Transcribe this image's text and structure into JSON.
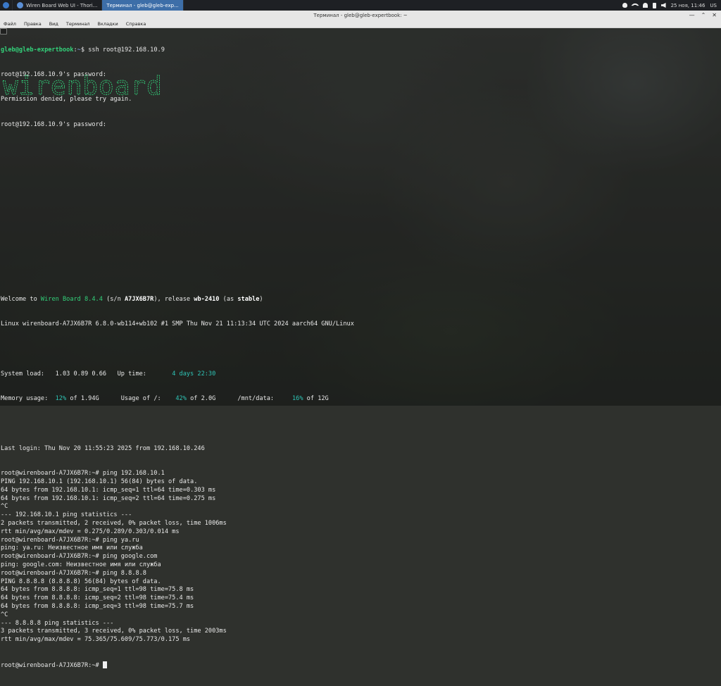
{
  "panel": {
    "tasks": [
      {
        "label": "Wiren Board Web UI - Thori...",
        "active": false
      },
      {
        "label": "Терминал - gleb@gleb-exp...",
        "active": true
      }
    ],
    "datetime": "25 ноя, 11:46",
    "keyboard_layout": "US"
  },
  "window": {
    "title": "Терминал - gleb@gleb-expertbook: ~",
    "menu": [
      "Файл",
      "Правка",
      "Вид",
      "Терминал",
      "Вкладки",
      "Справка"
    ]
  },
  "terminal": {
    "local_prompt_user": "gleb@gleb-expertbook",
    "local_prompt_path": "~",
    "local_cmd": "ssh root@192.168.10.9",
    "pw1": "root@192.168.10.9's password:",
    "denied": "Permission denied, please try again.",
    "pw2": "root@192.168.10.9's password:",
    "logo_text": "wirenboard",
    "welcome": {
      "prefix": "Welcome to ",
      "product": "Wiren Board 8.4.4",
      "sn_prefix": " (s/n ",
      "sn": "A7JX6B7R",
      "sn_suffix": "), release ",
      "release": "wb-2410",
      "as_prefix": " (as ",
      "as": "stable",
      "as_suffix": ")"
    },
    "uname": "Linux wirenboard-A7JX6B7R 6.8.0-wb114+wb102 #1 SMP Thu Nov 21 11:13:34 UTC 2024 aarch64 GNU/Linux",
    "sysload_label": "System load:   ",
    "sysload": "1.03 0.89 0.66",
    "uptime_label": "   Up time:       ",
    "uptime": "4 days 22:30",
    "mem_label": "Memory usage:  ",
    "mem_pct": "12%",
    "mem_of": " of 1.94G",
    "root_label": "      Usage of /:    ",
    "root_pct": "42%",
    "root_of": " of 2.0G",
    "data_label": "      /mnt/data:     ",
    "data_pct": "16%",
    "data_of": " of 12G",
    "last_login": "Last login: Thu Nov 20 11:55:23 2025 from 192.168.10.246",
    "remote_prompt": "root@wirenboard-A7JX6B7R:~#",
    "output": [
      {
        "prompt": true,
        "text": " ping 192.168.10.1"
      },
      {
        "prompt": false,
        "text": "PING 192.168.10.1 (192.168.10.1) 56(84) bytes of data."
      },
      {
        "prompt": false,
        "text": "64 bytes from 192.168.10.1: icmp_seq=1 ttl=64 time=0.303 ms"
      },
      {
        "prompt": false,
        "text": "64 bytes from 192.168.10.1: icmp_seq=2 ttl=64 time=0.275 ms"
      },
      {
        "prompt": false,
        "text": "^C"
      },
      {
        "prompt": false,
        "text": "--- 192.168.10.1 ping statistics ---"
      },
      {
        "prompt": false,
        "text": "2 packets transmitted, 2 received, 0% packet loss, time 1006ms"
      },
      {
        "prompt": false,
        "text": "rtt min/avg/max/mdev = 0.275/0.289/0.303/0.014 ms"
      },
      {
        "prompt": true,
        "text": " ping ya.ru"
      },
      {
        "prompt": false,
        "text": "ping: ya.ru: Неизвестное имя или служба"
      },
      {
        "prompt": true,
        "text": " ping google.com"
      },
      {
        "prompt": false,
        "text": "ping: google.com: Неизвестное имя или служба"
      },
      {
        "prompt": true,
        "text": " ping 8.8.8.8"
      },
      {
        "prompt": false,
        "text": "PING 8.8.8.8 (8.8.8.8) 56(84) bytes of data."
      },
      {
        "prompt": false,
        "text": "64 bytes from 8.8.8.8: icmp_seq=1 ttl=98 time=75.8 ms"
      },
      {
        "prompt": false,
        "text": "64 bytes from 8.8.8.8: icmp_seq=2 ttl=98 time=75.4 ms"
      },
      {
        "prompt": false,
        "text": "64 bytes from 8.8.8.8: icmp_seq=3 ttl=98 time=75.7 ms"
      },
      {
        "prompt": false,
        "text": "^C"
      },
      {
        "prompt": false,
        "text": "--- 8.8.8.8 ping statistics ---"
      },
      {
        "prompt": false,
        "text": "3 packets transmitted, 3 received, 0% packet loss, time 2003ms"
      },
      {
        "prompt": false,
        "text": "rtt min/avg/max/mdev = 75.365/75.609/75.773/0.175 ms"
      }
    ]
  },
  "colors": {
    "prompt_green": "#33d17a",
    "prompt_path": "#8fb3ff",
    "accent_cyan": "#2ec4b6",
    "active_task": "#3d6ea8"
  }
}
